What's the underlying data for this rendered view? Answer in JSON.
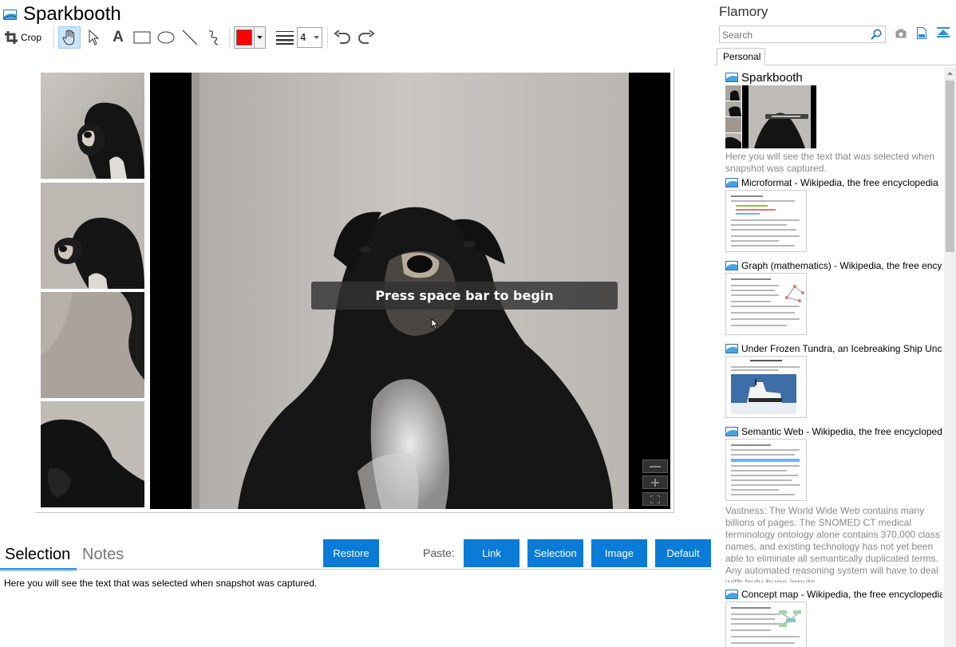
{
  "app": {
    "title": "Sparkbooth"
  },
  "toolbar": {
    "crop_label": "Crop",
    "text_tool_glyph": "A",
    "pen_color": "#ff0000",
    "line_width_value": "4"
  },
  "canvas": {
    "overlay_message": "Press space bar to begin"
  },
  "bottom": {
    "tabs": [
      {
        "label": "Selection",
        "active": true
      },
      {
        "label": "Notes",
        "active": false
      }
    ],
    "restore_label": "Restore",
    "paste_label": "Paste:",
    "paste_buttons": [
      "Link",
      "Selection",
      "Image",
      "Default"
    ],
    "selection_text": "Here you will see the text that was selected when snapshot was captured."
  },
  "flamory": {
    "title": "Flamory",
    "search_placeholder": "Search",
    "tab_label": "Personal",
    "entries": [
      {
        "title": "Sparkbooth",
        "description": "Here you will see the text that was selected when snapshot was captured."
      },
      {
        "title": "Microformat - Wikipedia, the free encyclopedia"
      },
      {
        "title": "Graph (mathematics) - Wikipedia, the free ency"
      },
      {
        "title": "Under Frozen Tundra, an Icebreaking Ship Unco"
      },
      {
        "title": "Semantic Web - Wikipedia, the free encycloped",
        "description": "Vastness: The World Wide Web contains many billions of pages. The SNOMED CT medical terminology ontology alone contains 370,000 class names, and existing technology has not yet been able to eliminate all semantically duplicated terms. Any automated reasoning system will have to deal with truly huge inputs."
      },
      {
        "title": "Concept map - Wikipedia, the free encyclopedia"
      }
    ]
  },
  "colors": {
    "accent": "#0a7bd6",
    "selected_tool_bg": "#cce4f7"
  }
}
